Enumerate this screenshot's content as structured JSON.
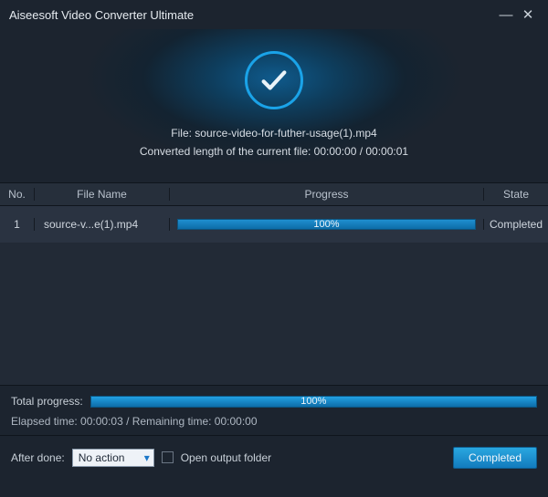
{
  "window": {
    "title": "Aiseesoft Video Converter Ultimate",
    "minimize": "—",
    "close": "✕"
  },
  "hero": {
    "file_label_prefix": "File: ",
    "file_name": "source-video-for-futher-usage(1).mp4",
    "converted_line": "Converted length of the current file: 00:00:00 / 00:00:01"
  },
  "table": {
    "headers": {
      "no": "No.",
      "file": "File Name",
      "progress": "Progress",
      "state": "State"
    },
    "rows": [
      {
        "no": "1",
        "file": "source-v...e(1).mp4",
        "percent": "100%",
        "state": "Completed"
      }
    ]
  },
  "total": {
    "label": "Total progress:",
    "percent": "100%",
    "elapsed_remaining": "Elapsed time: 00:00:03 / Remaining time: 00:00:00"
  },
  "footer": {
    "after_done_label": "After done:",
    "after_done_value": "No action",
    "open_output_label": "Open output folder",
    "button": "Completed"
  }
}
